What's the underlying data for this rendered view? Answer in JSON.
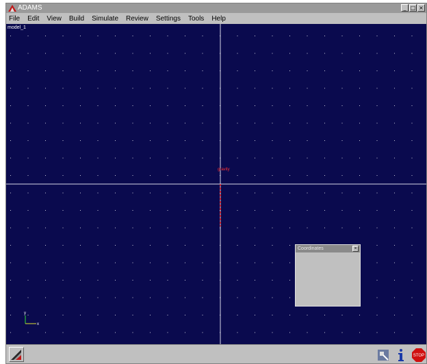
{
  "window": {
    "title": "ADAMS"
  },
  "menubar": {
    "items": [
      {
        "label": "File"
      },
      {
        "label": "Edit"
      },
      {
        "label": "View"
      },
      {
        "label": "Build"
      },
      {
        "label": "Simulate"
      },
      {
        "label": "Review"
      },
      {
        "label": "Settings"
      },
      {
        "label": "Tools"
      },
      {
        "label": "Help"
      }
    ]
  },
  "viewport": {
    "model_name": "model_1",
    "background_color": "#0a0a4e",
    "grid_color": "#c8c8d8",
    "axis_color": "#d8d8e8",
    "origin_label": "gravity",
    "gravity_color": "#ff2a2a",
    "triad": {
      "y_label": "y",
      "x_label": "x"
    }
  },
  "coordinates_panel": {
    "title": "Coordinates"
  },
  "statusbar": {
    "icons": [
      "adams-logo-icon",
      "tools-icon",
      "info-icon",
      "stop-icon"
    ],
    "stop_label": "STOP"
  }
}
